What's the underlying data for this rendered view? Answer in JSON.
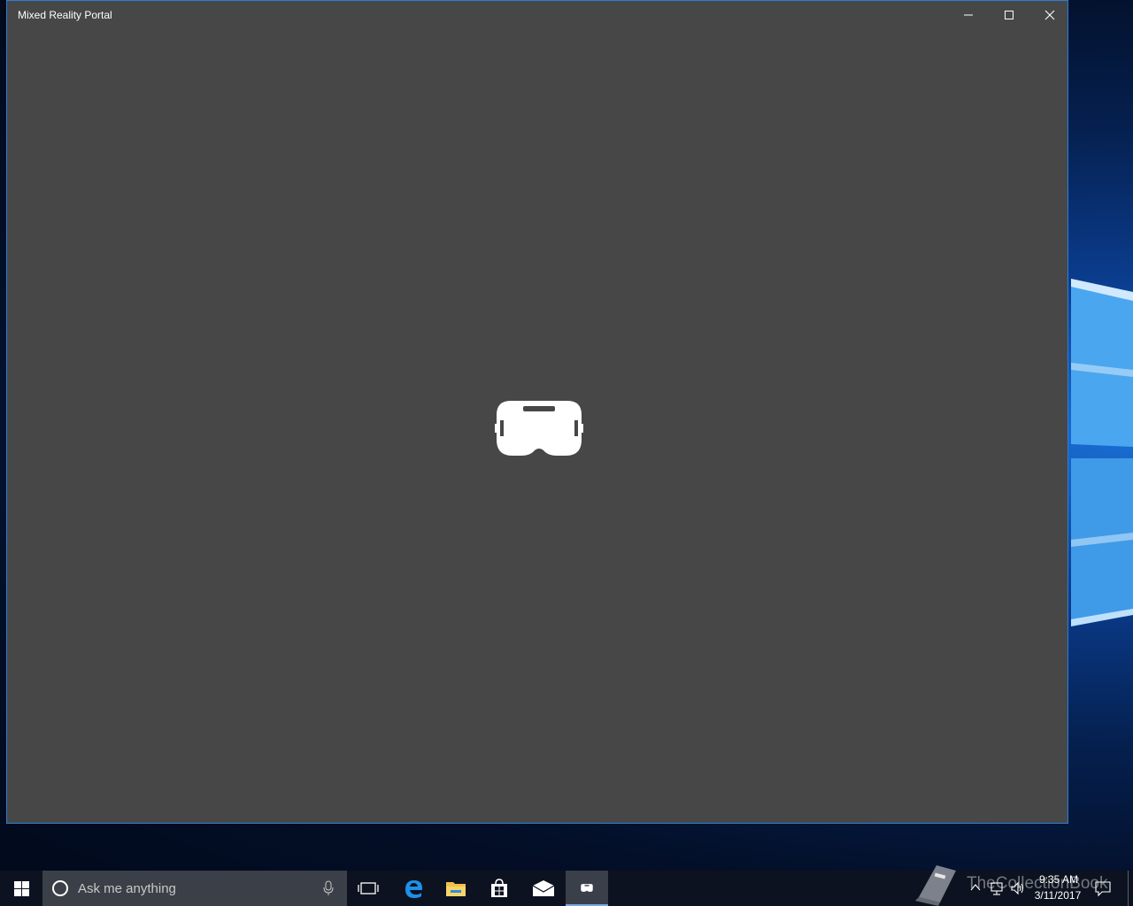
{
  "window": {
    "title": "Mixed Reality Portal",
    "minimize_icon": "minimize-icon",
    "maximize_icon": "maximize-icon",
    "close_icon": "close-icon",
    "center_icon": "vr-headset-icon",
    "background": "#474747",
    "border_color": "#2b7fd6"
  },
  "taskbar": {
    "start_icon": "windows-logo-icon",
    "search": {
      "placeholder": "Ask me anything",
      "cortana_icon": "cortana-circle-icon",
      "mic_icon": "microphone-icon"
    },
    "pinned": [
      {
        "name": "task-view",
        "icon": "task-view-icon"
      },
      {
        "name": "edge",
        "icon": "edge-icon"
      },
      {
        "name": "file-explorer",
        "icon": "folder-icon"
      },
      {
        "name": "store",
        "icon": "store-bag-icon"
      },
      {
        "name": "mail",
        "icon": "mail-icon"
      },
      {
        "name": "mixed-reality-portal",
        "icon": "vr-headset-icon",
        "active": true
      }
    ],
    "tray": {
      "chevron_icon": "chevron-up-icon",
      "network_icon": "network-icon",
      "volume_icon": "volume-icon",
      "time": "9:35 AM",
      "date": "3/11/2017",
      "notification_icon": "action-center-icon"
    },
    "watermark": "TheCollectionBook"
  }
}
